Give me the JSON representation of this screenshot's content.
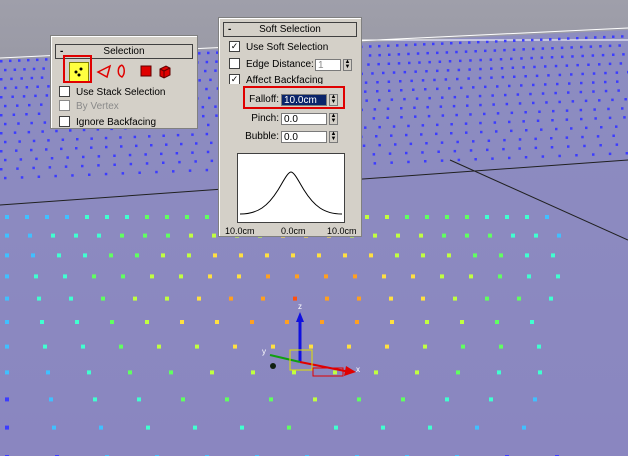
{
  "selection_panel": {
    "title": "Selection",
    "collapse_symbol": "-",
    "subobject_icons": [
      "vertex-icon",
      "edge-icon",
      "border-icon",
      "polygon-icon",
      "element-icon"
    ],
    "active_subobject": "vertex",
    "use_stack_selection_label": "Use Stack Selection",
    "by_vertex_label": "By Vertex",
    "ignore_backfacing_label": "Ignore Backfacing"
  },
  "soft_selection_panel": {
    "title": "Soft Selection",
    "collapse_symbol": "-",
    "use_soft_selection": {
      "label": "Use Soft Selection",
      "checked": true
    },
    "edge_distance": {
      "label": "Edge Distance:",
      "checked": false,
      "value": "1"
    },
    "affect_backfacing": {
      "label": "Affect Backfacing",
      "checked": true
    },
    "falloff": {
      "label": "Falloff:",
      "value": "10.0cm"
    },
    "pinch": {
      "label": "Pinch:",
      "value": "0.0"
    },
    "bubble": {
      "label": "Bubble:",
      "value": "0.0"
    },
    "curve_labels": {
      "left": "10.0cm",
      "center": "0.0cm",
      "right": "10.0cm"
    }
  },
  "viewport": {
    "gizmo_axes": [
      "z",
      "x",
      "y"
    ],
    "colors": {
      "background": "#9a9aad",
      "vertex_blue": "#3c3cff",
      "accent_red": "#e00000"
    }
  }
}
